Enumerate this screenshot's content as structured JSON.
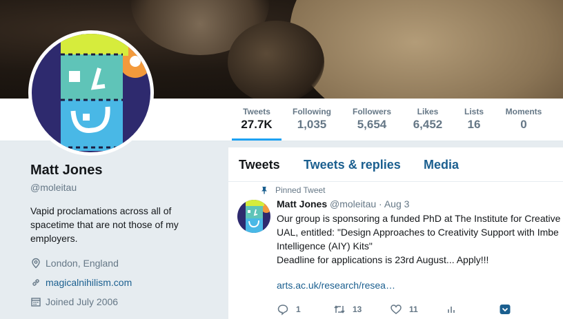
{
  "nav": {
    "stats": [
      {
        "label": "Tweets",
        "value": "27.7K"
      },
      {
        "label": "Following",
        "value": "1,035"
      },
      {
        "label": "Followers",
        "value": "5,654"
      },
      {
        "label": "Likes",
        "value": "6,452"
      },
      {
        "label": "Lists",
        "value": "16"
      },
      {
        "label": "Moments",
        "value": "0"
      }
    ]
  },
  "profile": {
    "name": "Matt Jones",
    "handle": "@moleitau",
    "bio": [
      "Vapid proclamations across all of",
      "spacetime that are not those of my",
      "employers."
    ],
    "location": "London, England",
    "website": "magicalnihilism.com",
    "joined": "Joined July 2006"
  },
  "timeline": {
    "tabs": [
      "Tweets",
      "Tweets & replies",
      "Media"
    ],
    "pinned_label": "Pinned Tweet",
    "tweet": {
      "name": "Matt Jones",
      "handle": "@moleitau",
      "date": "· Aug 3",
      "lines": [
        "Our group is sponsoring a funded PhD at The Institute for Creative",
        "UAL, entitled: \"Design Approaches to Creativity Support with Imbe",
        "Intelligence (AIY) Kits\"",
        "Deadline for applications is 23rd August... Apply!!!"
      ],
      "link": "arts.ac.uk/research/resea…",
      "replies": "1",
      "retweets": "13",
      "likes": "11"
    }
  },
  "colors": {
    "accent": "#1da1f2",
    "link": "#1b5f8f",
    "muted": "#657786"
  }
}
